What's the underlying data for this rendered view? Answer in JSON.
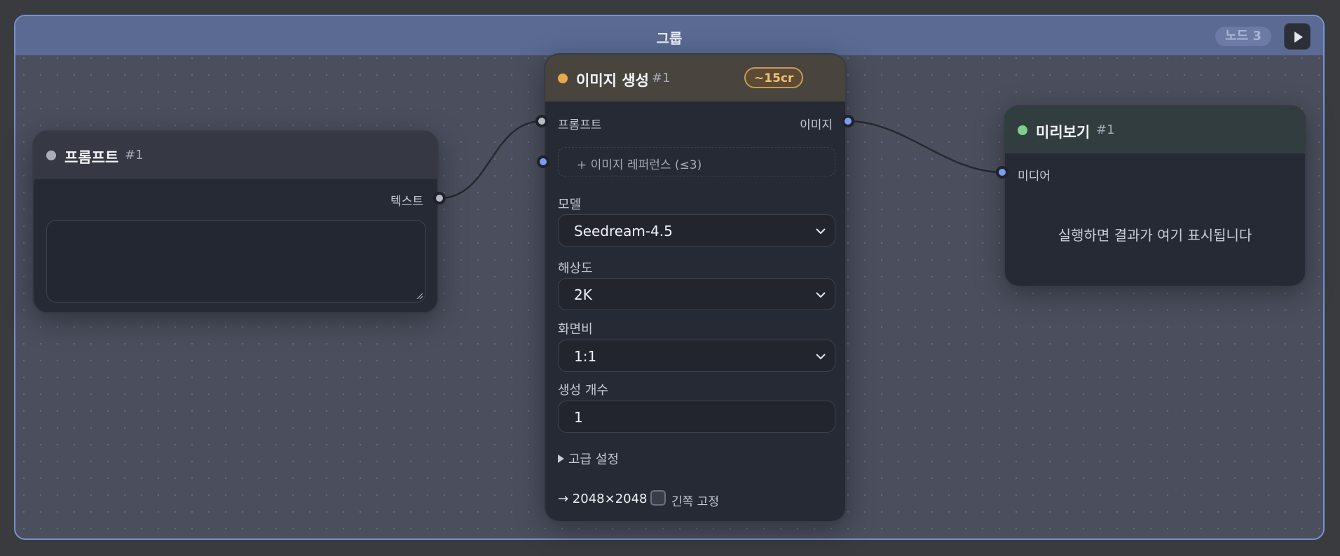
{
  "group": {
    "title": "그룹",
    "badge": "노드 3",
    "accent": "#7b8fd0"
  },
  "prompt_node": {
    "title": "프롬프트",
    "number": "#1",
    "status_color": "#a9adb8",
    "output_label": "텍스트",
    "text_value": ""
  },
  "image_gen_node": {
    "title": "이미지 생성",
    "number": "#1",
    "status_color": "#e8a94a",
    "cost": "~15cr",
    "input_prompt_label": "프롬프트",
    "output_image_label": "이미지",
    "reference_label": "+ 이미지 레퍼런스 (≤3)",
    "model_label": "모델",
    "model_value": "Seedream-4.5",
    "resolution_label": "해상도",
    "resolution_value": "2K",
    "aspect_label": "화면비",
    "aspect_value": "1:1",
    "count_label": "생성 개수",
    "count_value": "1",
    "advanced_label": "고급 설정",
    "output_size": "→ 2048×2048",
    "lock_label": "긴쪽 고정",
    "lock_checked": false
  },
  "preview_node": {
    "title": "미리보기",
    "number": "#1",
    "status_color": "#7fcf8c",
    "input_label": "미디어",
    "placeholder": "실행하면 결과가 여기 표시됩니다"
  },
  "icons": {
    "run": "play-icon",
    "select": "chevron-down-icon",
    "advanced": "triangle-right-icon"
  }
}
